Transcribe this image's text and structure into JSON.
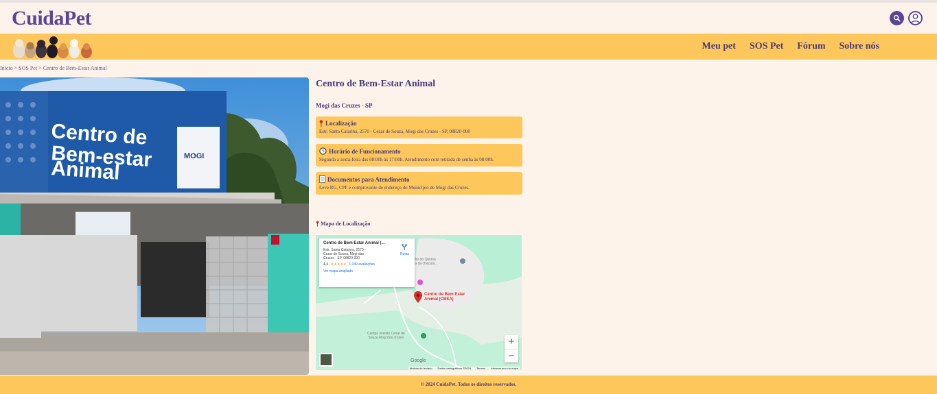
{
  "header": {
    "logo": "CuidaPet"
  },
  "nav": {
    "items": [
      "Meu pet",
      "SOS Pet",
      "Fórum",
      "Sobre nós"
    ]
  },
  "breadcrumb": "Início > SOS Pet > Centro de Bem-Estar Animal",
  "hero": {
    "sign_line1": "Centro de",
    "sign_line2": "Bem-estar",
    "sign_line3": "Animal",
    "sign_logo": "MOGI"
  },
  "info": {
    "title": "Centro de Bem-Estar Animal",
    "city": "Mogi das Cruzes - SP",
    "cards": [
      {
        "icon": "pin-icon",
        "title": "Localização",
        "text": "Estr. Santa Catarina, 2570 - Cezar de Souza, Mogi das Cruzes - SP, 08820-000"
      },
      {
        "icon": "clock-icon",
        "title": "Horário de Funcionamento",
        "text": "Segunda a sexta-feira das 08:00h às 17:00h. Atendimento com retirada de senha às 08:00h."
      },
      {
        "icon": "document-icon",
        "title": "Documentos para Atendimento",
        "text": "Leve RG, CPF e comprovante de endereço do Município de Mogi das Cruzes."
      }
    ]
  },
  "map": {
    "title": "Mapa de Localização",
    "card_name": "Centro de Bem Estar Animal (...",
    "card_address": "Estr. Santa Catarina, 2570 - Cezar de Souza, Mogi das Cruzes - SP, 08820-000",
    "rating": "4,4",
    "stars": "★★★★★",
    "reviews": "1.049 avaliações",
    "larger_map": "Ver mapa ampliado",
    "routes": "Rotas",
    "pin_label_1": "Centro de Bem Estar",
    "pin_label_2": "Animal (CBEA)",
    "place_1a": "Rancho do Quirino",
    "place_1b": "na rua da chácara...",
    "place_2a": "Campo society Cesar de",
    "place_2b": "Souza Mogi das cruzes",
    "zoom_in": "+",
    "zoom_out": "−",
    "google": "Google",
    "footer": [
      "Atalhos do teclado",
      "Dados cartográficos ©2024",
      "Termos",
      "Informar erro no mapa"
    ]
  },
  "footer": {
    "copyright": "© 2024 CuidaPet. Todos os direitos reservados."
  },
  "colors": {
    "brand": "#5b4694",
    "accent": "#fdc75c",
    "background": "#fdf3ea"
  }
}
